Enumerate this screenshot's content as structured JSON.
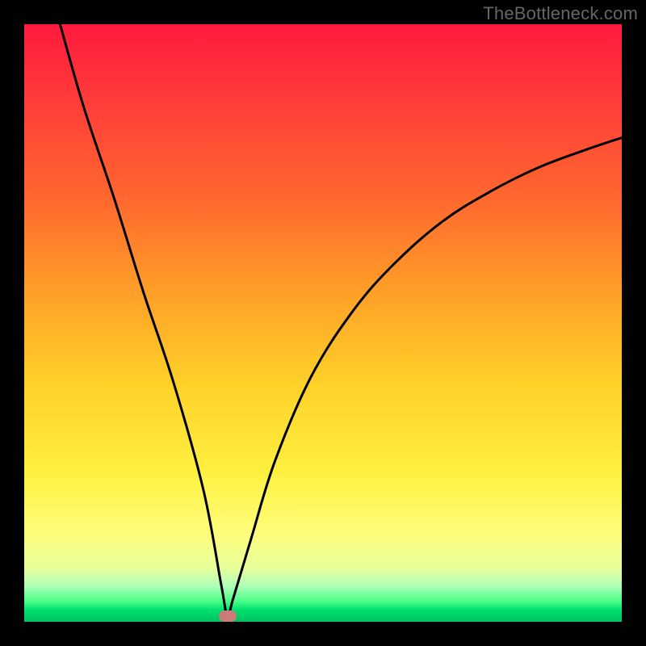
{
  "watermark": "TheBottleneck.com",
  "colors": {
    "frame": "#000000",
    "gradient_top": "#ff1a3c",
    "gradient_mid_orange": "#ffa028",
    "gradient_mid_yellow": "#fff040",
    "gradient_bottom_green": "#00c060",
    "curve_stroke": "#000000",
    "marker_fill": "#cc7a7a"
  },
  "chart_data": {
    "type": "line",
    "title": "",
    "xlabel": "",
    "ylabel": "",
    "xlim": [
      0,
      100
    ],
    "ylim": [
      0,
      100
    ],
    "legend": false,
    "grid": false,
    "annotations": [
      {
        "type": "min_marker",
        "x": 34,
        "y": 1
      }
    ],
    "series": [
      {
        "name": "bottleneck_curve",
        "x": [
          6,
          10,
          15,
          20,
          25,
          30,
          33,
          34,
          35,
          38,
          42,
          48,
          55,
          62,
          70,
          78,
          86,
          94,
          100
        ],
        "y": [
          100,
          86,
          71,
          55,
          40,
          22,
          6,
          1,
          4,
          14,
          27,
          41,
          52,
          60,
          67,
          72,
          76,
          79,
          81
        ]
      }
    ]
  }
}
